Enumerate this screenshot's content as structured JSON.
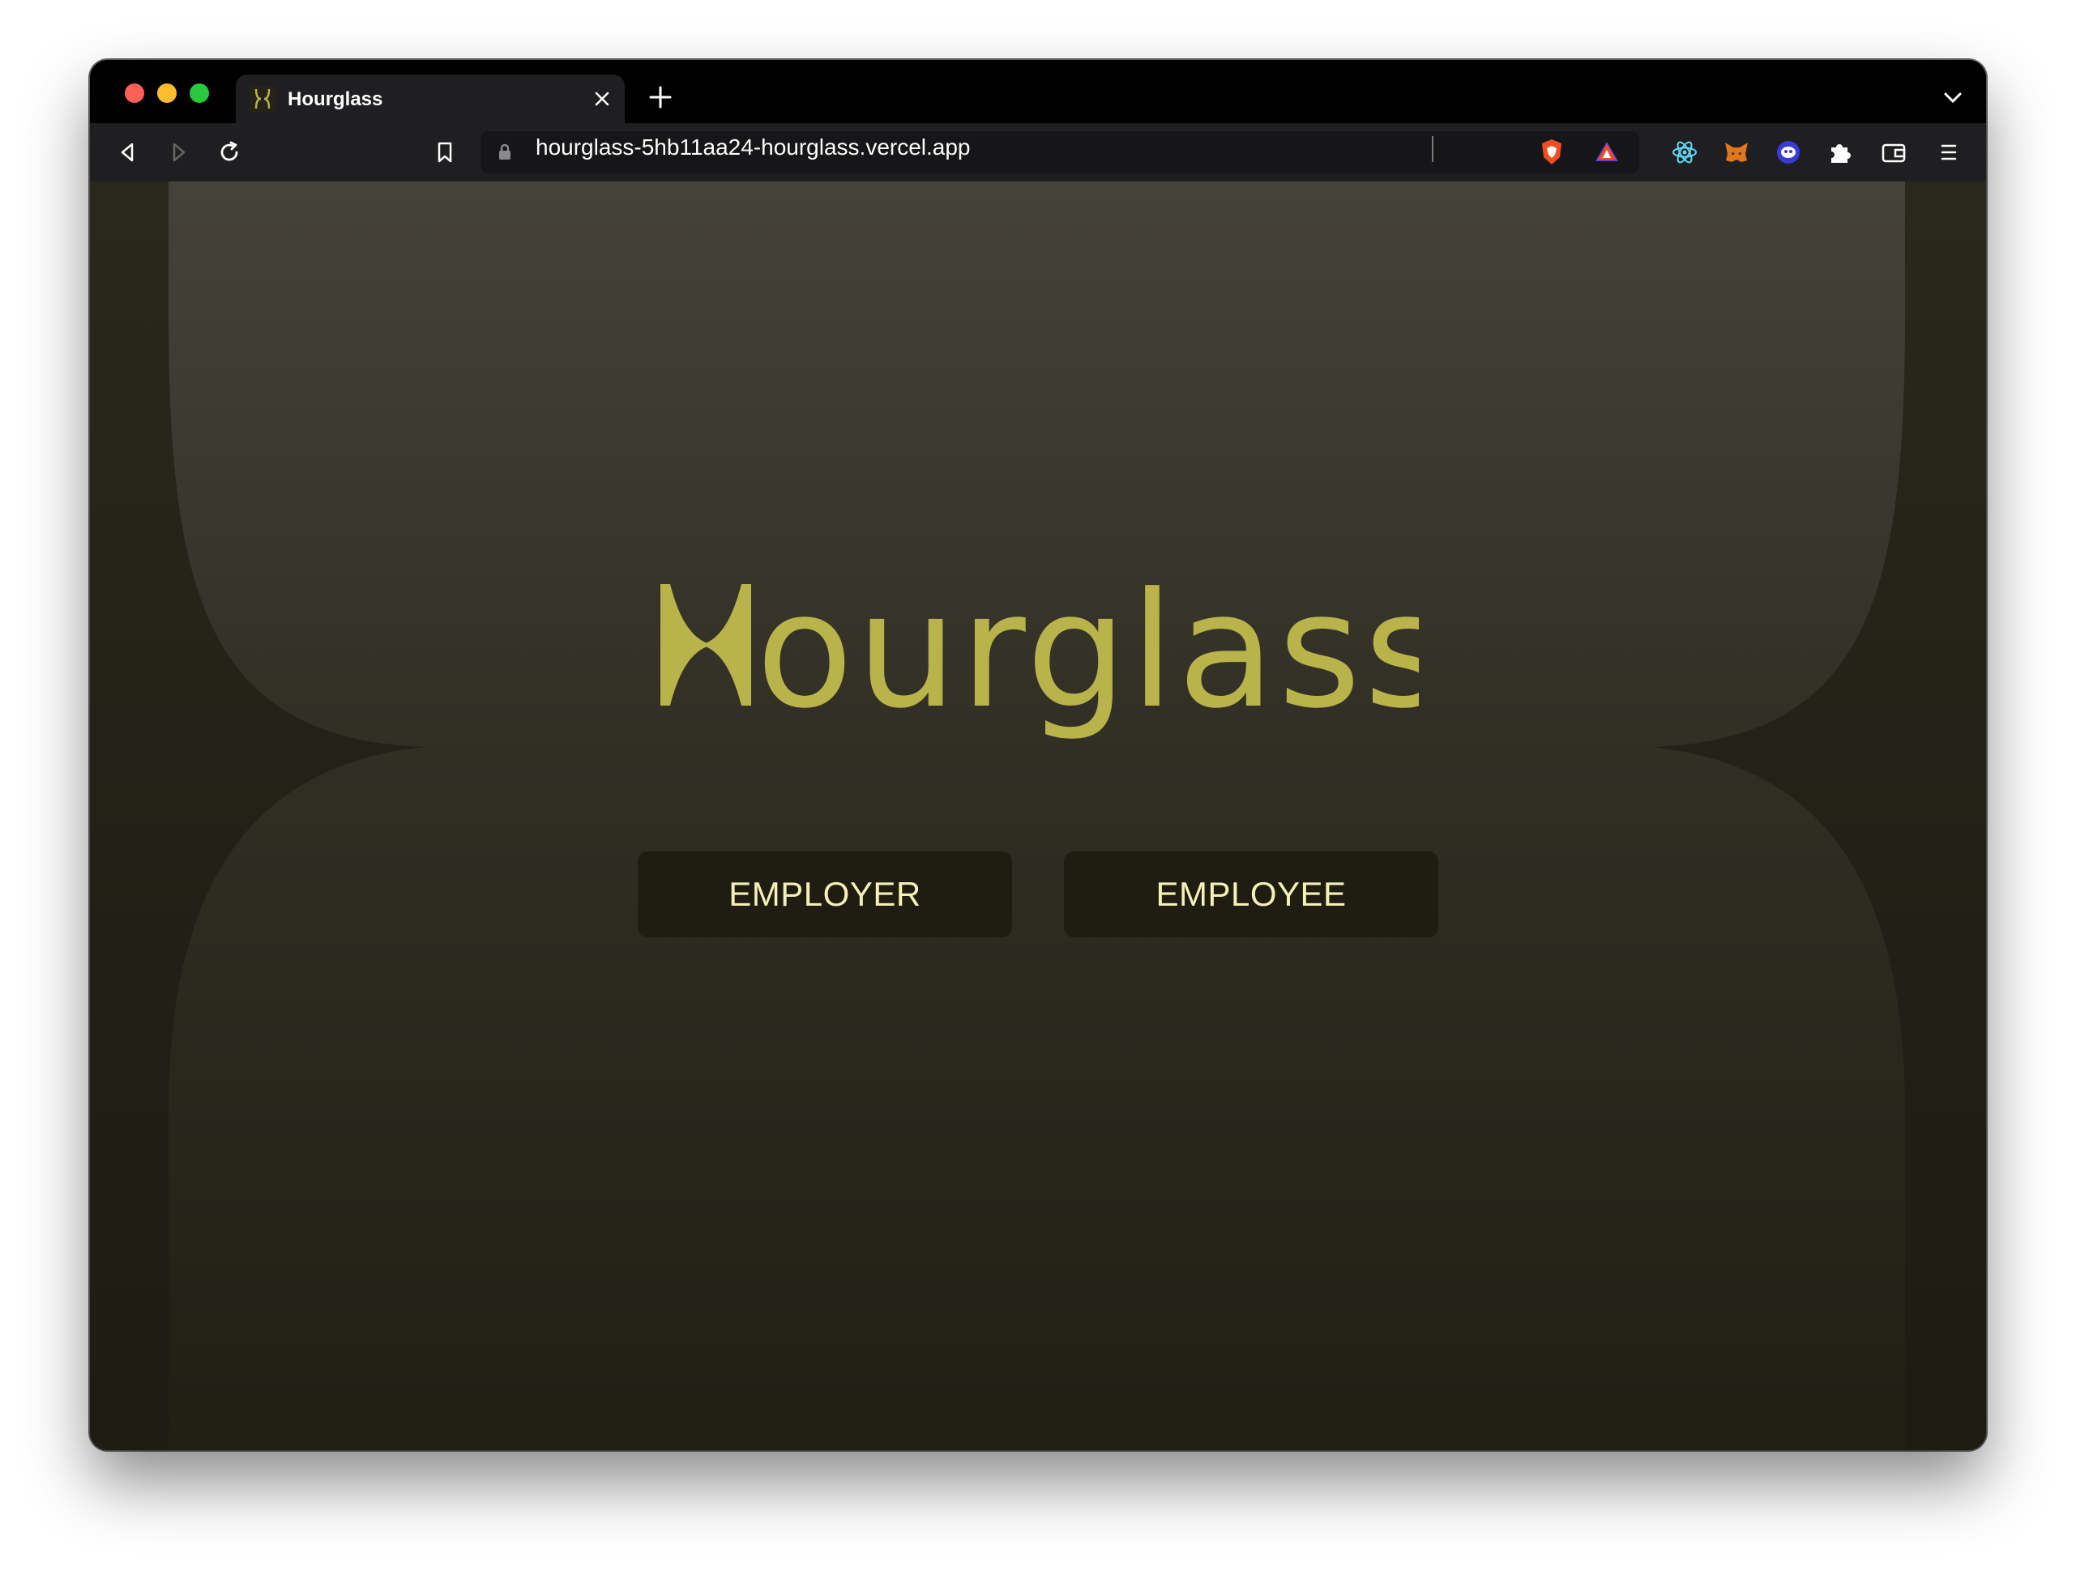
{
  "browser": {
    "tab": {
      "title": "Hourglass",
      "favicon": "hourglass-logo-icon"
    },
    "url": "hourglass-5hb11aa24-hourglass.vercel.app",
    "toolbar_icons": [
      "back-icon",
      "forward-icon",
      "reload-icon",
      "bookmark-icon",
      "lock-icon",
      "brave-shield-icon",
      "brave-rewards-icon",
      "react-devtools-icon",
      "metamask-icon",
      "extension-icon",
      "puzzle-icon",
      "wallet-icon",
      "menu-icon"
    ]
  },
  "page": {
    "logo_text": "Hourglass",
    "buttons": {
      "employer": "EMPLOYER",
      "employee": "EMPLOYEE"
    }
  },
  "colors": {
    "accent": "#b8b34a",
    "background_top": "#45423a",
    "background_bottom": "#1d1b12",
    "button_bg": "#1f1d11",
    "button_text": "#f5efb8"
  }
}
